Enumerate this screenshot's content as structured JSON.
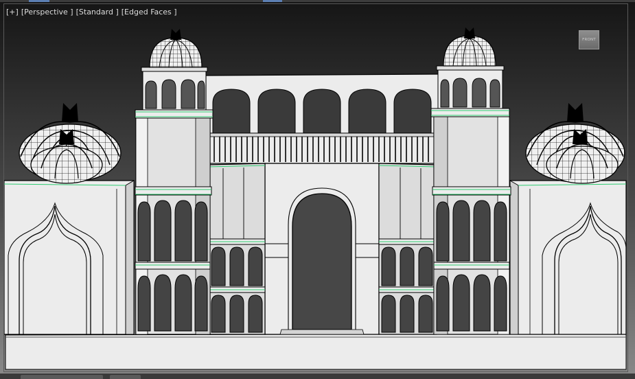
{
  "viewport": {
    "labels": {
      "plus": "[+]",
      "view": "[Perspective ]",
      "shading": "[Standard ]",
      "display": "[Edged Faces ]"
    },
    "viewcube_face": "FRONT"
  },
  "colors": {
    "background_top": "#181818",
    "background_bottom": "#7d7d7d",
    "surface": "#ebebeb",
    "shadow_surface": "#c9c9c9",
    "edge": "#000000",
    "selected_edge": "#2ecc71",
    "opening": "#4a4a4a"
  },
  "icons": {
    "viewcube": "viewcube-icon"
  }
}
